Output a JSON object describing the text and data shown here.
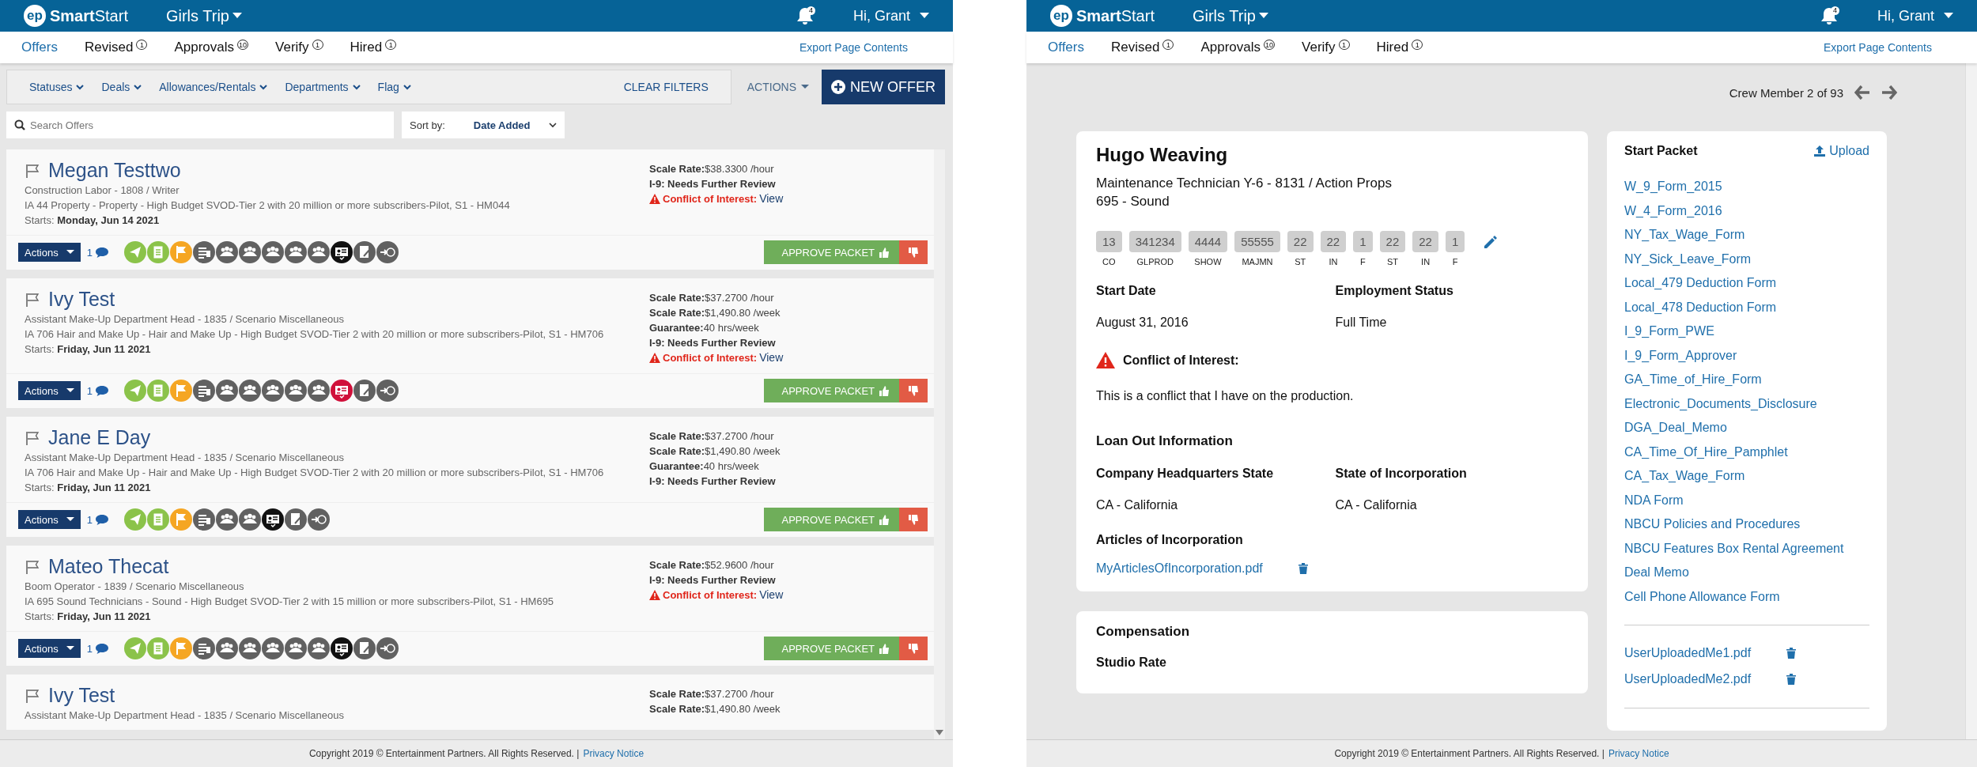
{
  "left_screen": {
    "header": {
      "logo_mark": "ep",
      "logo_text": "**Smart**Start",
      "project": "Girls Trip",
      "notifications": "4",
      "user": "Hi, Grant"
    },
    "nav": {
      "tabs": [
        {
          "label": "Offers",
          "selected": true
        },
        {
          "label": "Revised",
          "badge": "1",
          "selected": false
        },
        {
          "label": "Approvals",
          "badge": "10",
          "selected": false
        },
        {
          "label": "Verify",
          "badge": "1",
          "selected": false
        },
        {
          "label": "Hired",
          "badge": "1",
          "selected": false
        }
      ],
      "export": "Export Page Contents"
    },
    "filters": [
      "Statuses",
      "Deals",
      "Allowances/Rentals",
      "Departments",
      "Flag"
    ],
    "clear_filters": "CLEAR FILTERS",
    "actions": "ACTIONS",
    "new_offer": "NEW OFFER",
    "search": {
      "placeholder": "Search Offers"
    },
    "sort": {
      "label": "Sort by:",
      "value": "Date Added"
    },
    "offers": [
      {
        "name": "Megan Testtwo",
        "position": "Construction Labor - 1808 / Writer",
        "union": "IA 44 Property - Property - High Budget SVOD-Tier 2 with 20 million or more subscribers-Pilot, S1 - HM044",
        "starts_label": "Starts:",
        "starts": "Monday, Jun 14 2021",
        "rates": [
          {
            "label": "Scale Rate:",
            "value": "$38.3300 /hour"
          }
        ],
        "i9": "I-9: Needs Further Review",
        "conflict": {
          "label": "Conflict of Interest:",
          "link": "View"
        },
        "actions": "Actions",
        "comments": "1",
        "approve": "APPROVE PACKET",
        "icons": [
          {
            "kind": "send",
            "color": "#8bc34a"
          },
          {
            "kind": "doc",
            "color": "#8bc34a"
          },
          {
            "kind": "flag",
            "color": "#f5a623"
          },
          {
            "kind": "grid",
            "color": "#616161"
          },
          {
            "kind": "people",
            "color": "#616161"
          },
          {
            "kind": "people",
            "color": "#616161"
          },
          {
            "kind": "people",
            "color": "#616161"
          },
          {
            "kind": "people",
            "color": "#616161"
          },
          {
            "kind": "people",
            "color": "#616161"
          },
          {
            "kind": "id",
            "color": "#111111"
          },
          {
            "kind": "edit",
            "color": "#616161"
          },
          {
            "kind": "arrow",
            "color": "#616161"
          }
        ]
      },
      {
        "name": "Ivy Test",
        "position": "Assistant Make-Up Department Head - 1835 / Scenario Miscellaneous",
        "union": "IA 706 Hair and Make Up - Hair and Make Up - High Budget SVOD-Tier 2 with 20 million or more subscribers-Pilot, S1 - HM706",
        "starts_label": "Starts:",
        "starts": "Friday, Jun 11 2021",
        "rates": [
          {
            "label": "Scale Rate:",
            "value": "$37.2700 /hour"
          },
          {
            "label": "Scale Rate:",
            "value": "$1,490.80 /week"
          },
          {
            "label": "Guarantee:",
            "value": "40 hrs/week"
          }
        ],
        "i9": "I-9: Needs Further Review",
        "conflict": {
          "label": "Conflict of Interest:",
          "link": "View"
        },
        "actions": "Actions",
        "comments": "1",
        "approve": "APPROVE PACKET",
        "icons": [
          {
            "kind": "send",
            "color": "#8bc34a"
          },
          {
            "kind": "doc",
            "color": "#8bc34a"
          },
          {
            "kind": "flag",
            "color": "#f5a623"
          },
          {
            "kind": "grid",
            "color": "#616161"
          },
          {
            "kind": "people",
            "color": "#616161"
          },
          {
            "kind": "people",
            "color": "#616161"
          },
          {
            "kind": "people",
            "color": "#616161"
          },
          {
            "kind": "people",
            "color": "#616161"
          },
          {
            "kind": "people",
            "color": "#616161"
          },
          {
            "kind": "id",
            "color": "#d0103a"
          },
          {
            "kind": "edit",
            "color": "#616161"
          },
          {
            "kind": "arrow",
            "color": "#616161"
          }
        ]
      },
      {
        "name": "Jane E Day",
        "position": "Assistant Make-Up Department Head - 1835 / Scenario Miscellaneous",
        "union": "IA 706 Hair and Make Up - Hair and Make Up - High Budget SVOD-Tier 2 with 20 million or more subscribers-Pilot, S1 - HM706",
        "starts_label": "Starts:",
        "starts": "Friday, Jun 11 2021",
        "rates": [
          {
            "label": "Scale Rate:",
            "value": "$37.2700 /hour"
          },
          {
            "label": "Scale Rate:",
            "value": "$1,490.80 /week"
          },
          {
            "label": "Guarantee:",
            "value": "40 hrs/week"
          }
        ],
        "i9": "I-9: Needs Further Review",
        "actions": "Actions",
        "comments": "1",
        "approve": "APPROVE PACKET",
        "icons": [
          {
            "kind": "send",
            "color": "#8bc34a"
          },
          {
            "kind": "doc",
            "color": "#8bc34a"
          },
          {
            "kind": "flag",
            "color": "#f5a623"
          },
          {
            "kind": "grid",
            "color": "#616161"
          },
          {
            "kind": "people",
            "color": "#616161"
          },
          {
            "kind": "people",
            "color": "#616161"
          },
          {
            "kind": "id",
            "color": "#111111"
          },
          {
            "kind": "edit",
            "color": "#616161"
          },
          {
            "kind": "arrow",
            "color": "#616161"
          }
        ]
      },
      {
        "name": "Mateo Thecat",
        "position": "Boom Operator - 1839 / Scenario Miscellaneous",
        "union": "IA 695 Sound Technicians - Sound - High Budget SVOD-Tier 2 with 15 million or more subscribers-Pilot, S1 - HM695",
        "starts_label": "Starts:",
        "starts": "Friday, Jun 11 2021",
        "rates": [
          {
            "label": "Scale Rate:",
            "value": "$52.9600 /hour"
          }
        ],
        "i9": "I-9: Needs Further Review",
        "conflict": {
          "label": "Conflict of Interest:",
          "link": "View"
        },
        "actions": "Actions",
        "comments": "1",
        "approve": "APPROVE PACKET",
        "icons": [
          {
            "kind": "send",
            "color": "#8bc34a"
          },
          {
            "kind": "doc",
            "color": "#8bc34a"
          },
          {
            "kind": "flag",
            "color": "#f5a623"
          },
          {
            "kind": "grid",
            "color": "#616161"
          },
          {
            "kind": "people",
            "color": "#616161"
          },
          {
            "kind": "people",
            "color": "#616161"
          },
          {
            "kind": "people",
            "color": "#616161"
          },
          {
            "kind": "people",
            "color": "#616161"
          },
          {
            "kind": "people",
            "color": "#616161"
          },
          {
            "kind": "id",
            "color": "#111111"
          },
          {
            "kind": "edit",
            "color": "#616161"
          },
          {
            "kind": "arrow",
            "color": "#616161"
          }
        ]
      },
      {
        "name": "Ivy Test",
        "position": "Assistant Make-Up Department Head - 1835 / Scenario Miscellaneous",
        "rates": [
          {
            "label": "Scale Rate:",
            "value": "$37.2700 /hour"
          },
          {
            "label": "Scale Rate:",
            "value": "$1,490.80 /week"
          }
        ]
      }
    ],
    "footer": {
      "text": "Copyright 2019 © Entertainment Partners. All Rights Reserved. |",
      "link": "Privacy Notice"
    }
  },
  "right_screen": {
    "header": {
      "logo_mark": "ep",
      "logo_text": "**Smart**Start",
      "project": "Girls Trip",
      "notifications": "4",
      "user": "Hi, Grant"
    },
    "nav": {
      "tabs": [
        {
          "label": "Offers",
          "selected": true
        },
        {
          "label": "Revised",
          "badge": "1",
          "selected": false
        },
        {
          "label": "Approvals",
          "badge": "10",
          "selected": false
        },
        {
          "label": "Verify",
          "badge": "1",
          "selected": false
        },
        {
          "label": "Hired",
          "badge": "1",
          "selected": false
        }
      ],
      "export": "Export Page Contents"
    },
    "crew_nav": "Crew Member 2 of 93",
    "profile": {
      "name": "Hugo Weaving",
      "lines": [
        "Maintenance Technician Y-6 - 8131 / Action Props",
        "695 - Sound"
      ],
      "codes": [
        {
          "value": "13",
          "label": "CO"
        },
        {
          "value": "341234",
          "label": "GLPROD"
        },
        {
          "value": "4444",
          "label": "SHOW"
        },
        {
          "value": "55555",
          "label": "MAJMN"
        },
        {
          "value": "22",
          "label": "ST"
        },
        {
          "value": "22",
          "label": "IN"
        },
        {
          "value": "1",
          "label": "F"
        },
        {
          "value": "22",
          "label": "ST"
        },
        {
          "value": "22",
          "label": "IN"
        },
        {
          "value": "1",
          "label": "F"
        }
      ],
      "fields": [
        {
          "label": "Start Date",
          "value": "August 31, 2016"
        },
        {
          "label": "Employment Status",
          "value": "Full Time"
        }
      ],
      "conflict": {
        "title": "Conflict of Interest:",
        "text": "This is a conflict that I have on the production."
      },
      "loan_out": {
        "title": "Loan Out Information",
        "fields": [
          {
            "label": "Company Headquarters State",
            "value": "CA - California"
          },
          {
            "label": "State of Incorporation",
            "value": "CA - California"
          }
        ],
        "articles_label": "Articles of Incorporation",
        "file": "MyArticlesOfIncorporation.pdf"
      }
    },
    "compensation": {
      "title": "Compensation",
      "subtitle": "Studio Rate"
    },
    "start_packet": {
      "title": "Start Packet",
      "upload": "Upload",
      "forms": [
        "W_9_Form_2015",
        "W_4_Form_2016",
        "NY_Tax_Wage_Form",
        "NY_Sick_Leave_Form",
        "Local_479 Deduction Form",
        "Local_478 Deduction Form",
        "I_9_Form_PWE",
        "I_9_Form_Approver",
        "GA_Time_of_Hire_Form",
        "Electronic_Documents_Disclosure",
        "DGA_Deal_Memo",
        "CA_Time_Of_Hire_Pamphlet",
        "CA_Tax_Wage_Form",
        "NDA Form",
        "NBCU Policies and Procedures",
        "NBCU Features Box Rental Agreement",
        "Deal Memo",
        "Cell Phone Allowance Form"
      ],
      "uploads": [
        "UserUploadedMe1.pdf",
        "UserUploadedMe2.pdf"
      ]
    },
    "footer": {
      "text": "Copyright 2019 © Entertainment Partners. All Rights Reserved. |",
      "link": "Privacy Notice"
    }
  }
}
